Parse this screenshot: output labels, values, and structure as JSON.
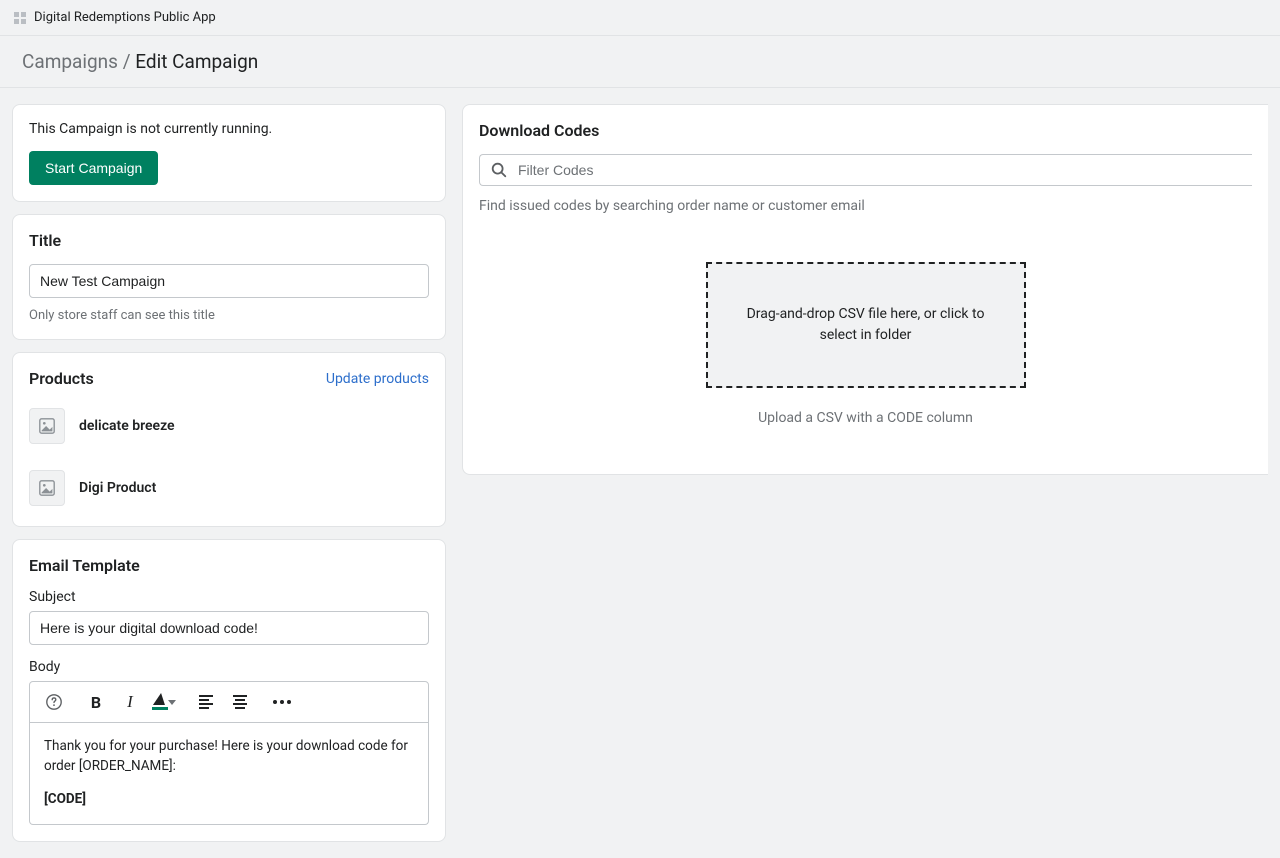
{
  "topbar": {
    "app_name": "Digital Redemptions Public App"
  },
  "breadcrumb": {
    "root": "Campaigns",
    "sep": "/",
    "current": "Edit Campaign"
  },
  "status_card": {
    "message": "This Campaign is not currently running.",
    "button": "Start Campaign"
  },
  "title_card": {
    "heading": "Title",
    "value": "New Test Campaign",
    "help": "Only store staff can see this title"
  },
  "products_card": {
    "heading": "Products",
    "update_link": "Update products",
    "items": [
      {
        "name": "delicate breeze"
      },
      {
        "name": "Digi Product"
      }
    ]
  },
  "email_card": {
    "heading": "Email Template",
    "subject_label": "Subject",
    "subject_value": "Here is your digital download code!",
    "body_label": "Body",
    "body_text": "Thank you for your purchase! Here is your download code for order [ORDER_NAME]:",
    "body_code": "[CODE]"
  },
  "codes_card": {
    "heading": "Download Codes",
    "filter_placeholder": "Filter Codes",
    "filter_help": "Find issued codes by searching order name or customer email",
    "dropzone_text": "Drag-and-drop CSV file here, or click to select in folder",
    "upload_hint": "Upload a CSV with a CODE column"
  }
}
